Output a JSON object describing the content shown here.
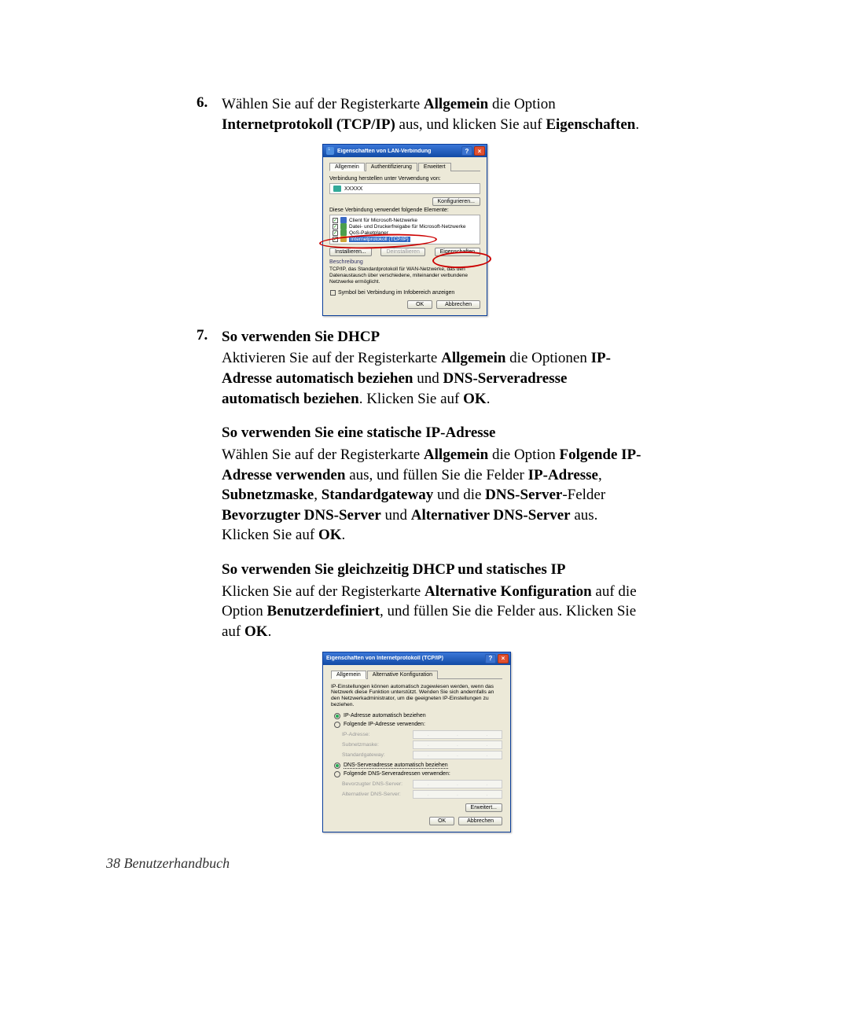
{
  "step6": {
    "num": "6.",
    "text_pre": "Wählen Sie auf der Registerkarte ",
    "b1": "Allgemein",
    "t2": " die Option ",
    "b2": "Internetprotokoll (TCP/IP)",
    "t3": " aus, und klicken Sie auf ",
    "b3": "Eigenschaften",
    "t4": "."
  },
  "dlg1": {
    "title": "Eigenschaften von LAN-Verbindung",
    "help": "?",
    "close": "×",
    "tabs": {
      "t1": "Allgemein",
      "t2": "Authentifizierung",
      "t3": "Erweitert"
    },
    "lbl_conn": "Verbindung herstellen unter Verwendung von:",
    "adapter": "XXXXX",
    "btn_cfg": "Konfigurieren...",
    "lbl_uses": "Diese Verbindung verwendet folgende Elemente:",
    "items": {
      "i1": "Client für Microsoft-Netzwerke",
      "i2": "Datei- und Druckerfreigabe für Microsoft-Netzwerke",
      "i3": "QoS-Paketplaner",
      "i4": "Internetprotokoll (TCP/IP)"
    },
    "btn_inst": "Installieren...",
    "btn_deinst": "Deinstallieren",
    "btn_prop": "Eigenschaften",
    "grp": "Beschreibung",
    "desc": "TCP/IP, das Standardprotokoll für WAN-Netzwerke, das den Datenaustausch über verschiedene, miteinander verbundene Netzwerke ermöglicht.",
    "chk": "Symbol bei Verbindung im Infobereich anzeigen",
    "ok": "OK",
    "cancel": "Abbrechen"
  },
  "step7": {
    "num": "7.",
    "head": "So verwenden Sie DHCP",
    "p1a": "Aktivieren Sie auf der Registerkarte ",
    "p1b1": "Allgemein",
    "p1c": " die Optionen ",
    "p1b2": "IP-Adresse automatisch beziehen",
    "p1d": " und ",
    "p1b3": "DNS-Serveradresse automatisch beziehen",
    "p1e": ". Klicken Sie auf ",
    "p1b4": "OK",
    "p1f": ".",
    "head2": "So verwenden Sie eine statische IP-Adresse",
    "p2a": "Wählen Sie auf der Registerkarte ",
    "p2b1": "Allgemein",
    "p2c": " die Option ",
    "p2b2": "Folgende IP-Adresse verwenden",
    "p2d": " aus, und füllen Sie die Felder ",
    "p2b3": "IP-Adresse",
    "p2e": ", ",
    "p2b4": "Subnetzmaske",
    "p2f": ", ",
    "p2b5": "Standardgateway",
    "p2g": " und die ",
    "p2b6": "DNS-Server",
    "p2h": "-Felder ",
    "p2b7": "Bevorzugter DNS-Server",
    "p2i": " und ",
    "p2b8": "Alternativer DNS-Server",
    "p2j": " aus. Klicken Sie auf ",
    "p2b9": "OK",
    "p2k": ".",
    "head3": "So verwenden Sie gleichzeitig DHCP und statisches IP",
    "p3a": "Klicken Sie auf der Registerkarte ",
    "p3b1": "Alternative Konfiguration",
    "p3c": " auf die Option ",
    "p3b2": "Benutzerdefiniert",
    "p3d": ", und füllen Sie die Felder aus. Klicken Sie auf ",
    "p3b3": "OK",
    "p3e": "."
  },
  "dlg2": {
    "title": "Eigenschaften von Internetprotokoll (TCP/IP)",
    "help": "?",
    "close": "×",
    "tabs": {
      "t1": "Allgemein",
      "t2": "Alternative Konfiguration"
    },
    "info": "IP-Einstellungen können automatisch zugewiesen werden, wenn das Netzwerk diese Funktion unterstützt. Wenden Sie sich andernfalls an den Netzwerkadministrator, um die geeigneten IP-Einstellungen zu beziehen.",
    "r1": "IP-Adresse automatisch beziehen",
    "r2": "Folgende IP-Adresse verwenden:",
    "f_ip": "IP-Adresse:",
    "f_sub": "Subnetzmaske:",
    "f_gw": "Standardgateway:",
    "r3": "DNS-Serveradresse automatisch beziehen",
    "r4": "Folgende DNS-Serveradressen verwenden:",
    "f_d1": "Bevorzugter DNS-Server:",
    "f_d2": "Alternativer DNS-Server:",
    "btn_adv": "Erweitert...",
    "ok": "OK",
    "cancel": "Abbrechen"
  },
  "footer": "38 Benutzerhandbuch"
}
